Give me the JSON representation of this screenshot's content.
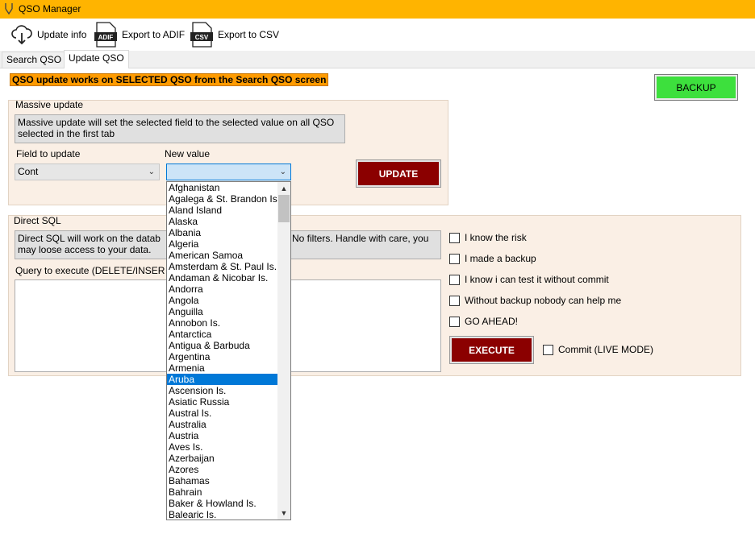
{
  "window": {
    "title": "QSO Manager"
  },
  "toolbar": {
    "update_info": "Update info",
    "adif_icon_text": "ADIF",
    "export_adif": "Export to ADIF",
    "csv_icon_text": "CSV",
    "export_csv": "Export to CSV"
  },
  "tabs": [
    {
      "label": "Search QSO",
      "active": false
    },
    {
      "label": "Update QSO",
      "active": true
    }
  ],
  "banner": "QSO update works on SELECTED QSO from the Search QSO screen",
  "backup_button": "BACKUP",
  "massive": {
    "title": "Massive update",
    "info": "Massive update will set the selected field to the selected value on all QSO selected in the first tab",
    "field_label": "Field to update",
    "field_value": "Cont",
    "value_label": "New value",
    "value_value": "",
    "update_button": "UPDATE"
  },
  "direct_sql": {
    "title": "Direct SQL",
    "info_visible": "Direct SQL will work on the datab",
    "info_line2": "may loose access to your data.",
    "info_right": "No filters. Handle with care, you",
    "query_label": "Query to execute (DELETE/INSER",
    "checkboxes": [
      {
        "label": "I know the risk",
        "checked": false
      },
      {
        "label": "I made a backup",
        "checked": false
      },
      {
        "label": "I know i can test it without commit",
        "checked": false
      },
      {
        "label": "Without backup nobody can help me",
        "checked": false
      },
      {
        "label": "GO AHEAD!",
        "checked": false
      }
    ],
    "execute_button": "EXECUTE",
    "commit_label": "Commit (LIVE MODE)"
  },
  "dropdown": {
    "selected": "Aruba",
    "items": [
      "Afghanistan",
      "Agalega & St. Brandon Is.",
      "Aland Island",
      "Alaska",
      "Albania",
      "Algeria",
      "American Samoa",
      "Amsterdam & St. Paul Is.",
      "Andaman & Nicobar Is.",
      "Andorra",
      "Angola",
      "Anguilla",
      "Annobon Is.",
      "Antarctica",
      "Antigua & Barbuda",
      "Argentina",
      "Armenia",
      "Aruba",
      "Ascension Is.",
      "Asiatic Russia",
      "Austral Is.",
      "Australia",
      "Austria",
      "Aves Is.",
      "Azerbaijan",
      "Azores",
      "Bahamas",
      "Bahrain",
      "Baker & Howland Is.",
      "Balearic Is."
    ]
  },
  "colors": {
    "titlebar": "#ffb400",
    "banner": "#ff9b00",
    "backup": "#3de03d",
    "action_button": "#8b0000",
    "selection": "#0078d7"
  }
}
